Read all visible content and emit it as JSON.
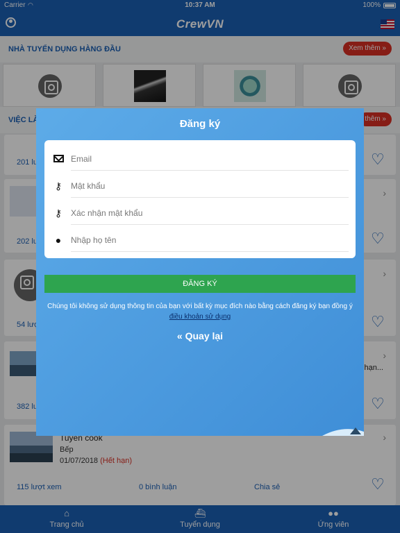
{
  "status_bar": {
    "carrier": "Carrier",
    "time": "10:37 AM",
    "battery": "100%"
  },
  "header": {
    "title": "CrewVN"
  },
  "sections": {
    "top_employers": {
      "label": "NHÀ TUYỂN DỤNG HÀNG ĐẦU",
      "more": "Xem thêm »"
    },
    "jobs": {
      "label": "VIỆC LÀ",
      "more": "thêm »"
    }
  },
  "jobs": [
    {
      "views": "201 lư"
    },
    {
      "views": "202 lư"
    },
    {
      "views": "54 lượ"
    },
    {
      "views": "382 lư",
      "truncated": "g hạn..."
    },
    {
      "title": "Tuyển cook",
      "position": "Bếp",
      "date": "01/07/2018",
      "status": "(Hết hạn)",
      "views": "115 lượt xem",
      "comments": "0 bình luận",
      "share": "Chia sẻ"
    }
  ],
  "modal": {
    "title": "Đăng ký",
    "fields": {
      "email": {
        "placeholder": "Email"
      },
      "password": {
        "placeholder": "Mật khẩu"
      },
      "confirm_password": {
        "placeholder": "Xác nhận mật khẩu"
      },
      "full_name": {
        "placeholder": "Nhập họ tên"
      }
    },
    "submit_label": "ĐĂNG KÝ",
    "terms_text": "Chúng tôi không sử dụng thông tin của bạn với bất kỳ mục đích nào bằng cách đăng ký bạn đồng ý",
    "terms_link": "điều khoản sử dụng",
    "back_label": "« Quay lại"
  },
  "tabs": [
    {
      "label": "Trang chủ",
      "icon": "home-icon"
    },
    {
      "label": "Tuyển dụng",
      "icon": "ship-icon"
    },
    {
      "label": "Ứng viên",
      "icon": "users-icon"
    }
  ],
  "colors": {
    "primary": "#1b5fb4",
    "accent_red": "#d93025",
    "submit_green": "#2ea44f"
  }
}
